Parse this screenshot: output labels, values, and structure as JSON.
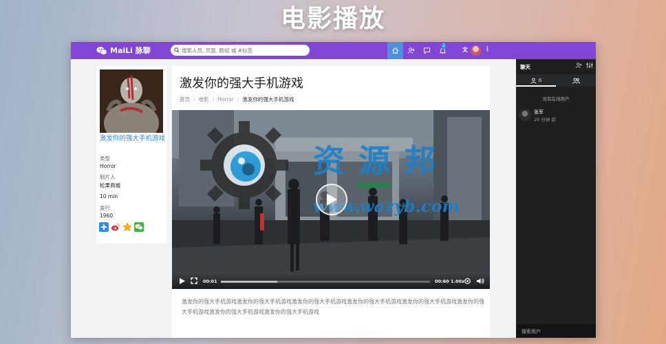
{
  "banner": {
    "title": "电影播放"
  },
  "topbar": {
    "brand": "MaiLi 脉聊",
    "search_placeholder": "搜索人员, 页面, 群组 或 #标签",
    "notifications_count": "2",
    "lang_label": "文",
    "icons": [
      "home-icon",
      "add-user-icon",
      "chat-icon",
      "bell-icon"
    ]
  },
  "movie": {
    "title": "激发你的强大手机游戏",
    "type_label": "类型",
    "type_value": "Horror",
    "producer_label": "制片人",
    "producer_value": "松果商城",
    "duration": "10 min",
    "release_label": "发行",
    "release_value": "1960"
  },
  "main": {
    "title": "激发你的强大手机游戏",
    "breadcrumbs": [
      "首页",
      "电影",
      "Horror",
      "激发你的强大手机游戏"
    ],
    "description": "激发你的强大手机游戏激发你的强大手机游戏激发你的强大手机游戏激发你的强大手机游戏激发你的强大手机游戏激发你的强大手机游戏激发你的强大手机游戏激发你的强大手机游戏"
  },
  "player": {
    "current_time": "00:01",
    "duration": "00:60",
    "speed": "1.00x",
    "progress_fraction": 0.0,
    "buffered_fraction": 0.27
  },
  "watermark": {
    "text": "资 源 邦",
    "url": "www.wazyb.com"
  },
  "chat": {
    "title": "聊天",
    "online_count": "0",
    "no_online": "没有在线用户",
    "user_name": "张军",
    "user_time": "20 分钟 前",
    "search_label": "搜索用户"
  }
}
